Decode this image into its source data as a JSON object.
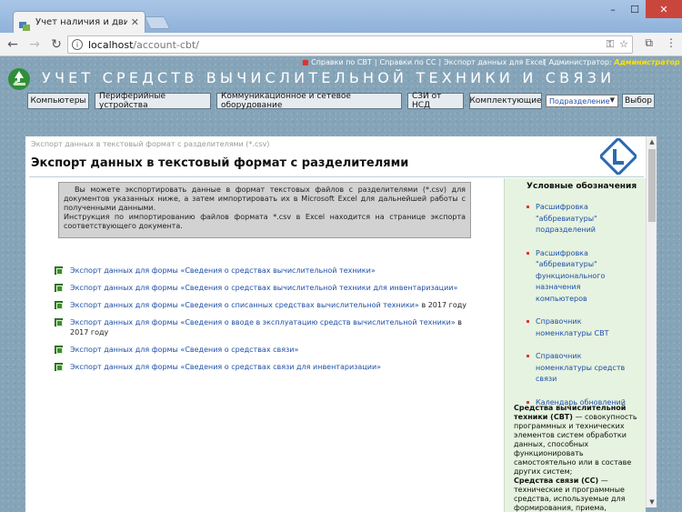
{
  "browser": {
    "tab_title": "Учет наличия и движен",
    "url_host": "localhost",
    "url_path": "/account-cbt/"
  },
  "header": {
    "toplinks": [
      "Справки по СВТ",
      "Справки по СС",
      "Экспорт данных для Excel"
    ],
    "admin_label": "[ Администратор:",
    "admin_role": "Администратор",
    "admin_close": "]",
    "site_title": "Учет средств вычислительной техники и связи"
  },
  "menu": {
    "items": [
      "Компьютеры",
      "Периферийные устройства",
      "Коммуникационное и сетевое оборудование",
      "СЗИ от НСД",
      "Комплектующие"
    ],
    "select_value": "Подразделение",
    "go_button": "Выбор"
  },
  "content": {
    "breadcrumb": "Экспорт данных в текстовый формат с разделителями (*.csv)",
    "title": "Экспорт данных в текстовый формат с разделителями",
    "info_p1": "Вы можете экспортировать данные в формат текстовых файлов с разделителями (*.csv) для документов указанных ниже, а затем импортировать их в Microsoft Excel для дальнейшей работы с полученными данными.",
    "info_p2": "Инструкция по импортированию файлов формата *.csv в Excel находится на странице экспорта соответствующего документа.",
    "links": [
      {
        "text": "Экспорт данных для формы «Сведения о средствах вычислительной техники»",
        "suffix": ""
      },
      {
        "text": "Экспорт данных для формы «Сведения о средствах вычислительной техники для инвентаризации»",
        "suffix": ""
      },
      {
        "text": "Экспорт данных для формы «Сведения о списанных средствах вычислительной техники»",
        "suffix": " в 2017 году"
      },
      {
        "text": "Экспорт данных для формы «Сведения о вводе в эксплуатацию средств вычислительной техники»",
        "suffix": " в 2017 году"
      },
      {
        "text": "Экспорт данных для формы «Сведения о средствах связи»",
        "suffix": ""
      },
      {
        "text": "Экспорт данных для формы «Сведения о средствах связи для инвентаризации»",
        "suffix": ""
      }
    ]
  },
  "sidebar": {
    "title": "Условные обозначения",
    "items": [
      "Расшифровка \"аббревиатуры\" подразделений",
      "Расшифровка \"аббревиатуры\" функционального назначения компьютеров",
      "Справочник номенклатуры СВТ",
      "Справочник номенклатуры средств связи",
      "Календарь обновлений"
    ],
    "def1_term": "Средства вычислительной техники (СВТ)",
    "def1_text": " — совокупность программных и технических элементов систем обработки данных, способных функционировать самостоятельно или в составе других систем;",
    "def2_term": "Средства связи (СС)",
    "def2_text": " — технические и программные средства, используемые для формирования, приема, обработки, хранения, передачи,"
  },
  "colors": {
    "link": "#1f4fa8",
    "admin_role": "#ffe100",
    "sidebar_bg": "#e6f3e0",
    "page_bg": "#86a4b8"
  }
}
